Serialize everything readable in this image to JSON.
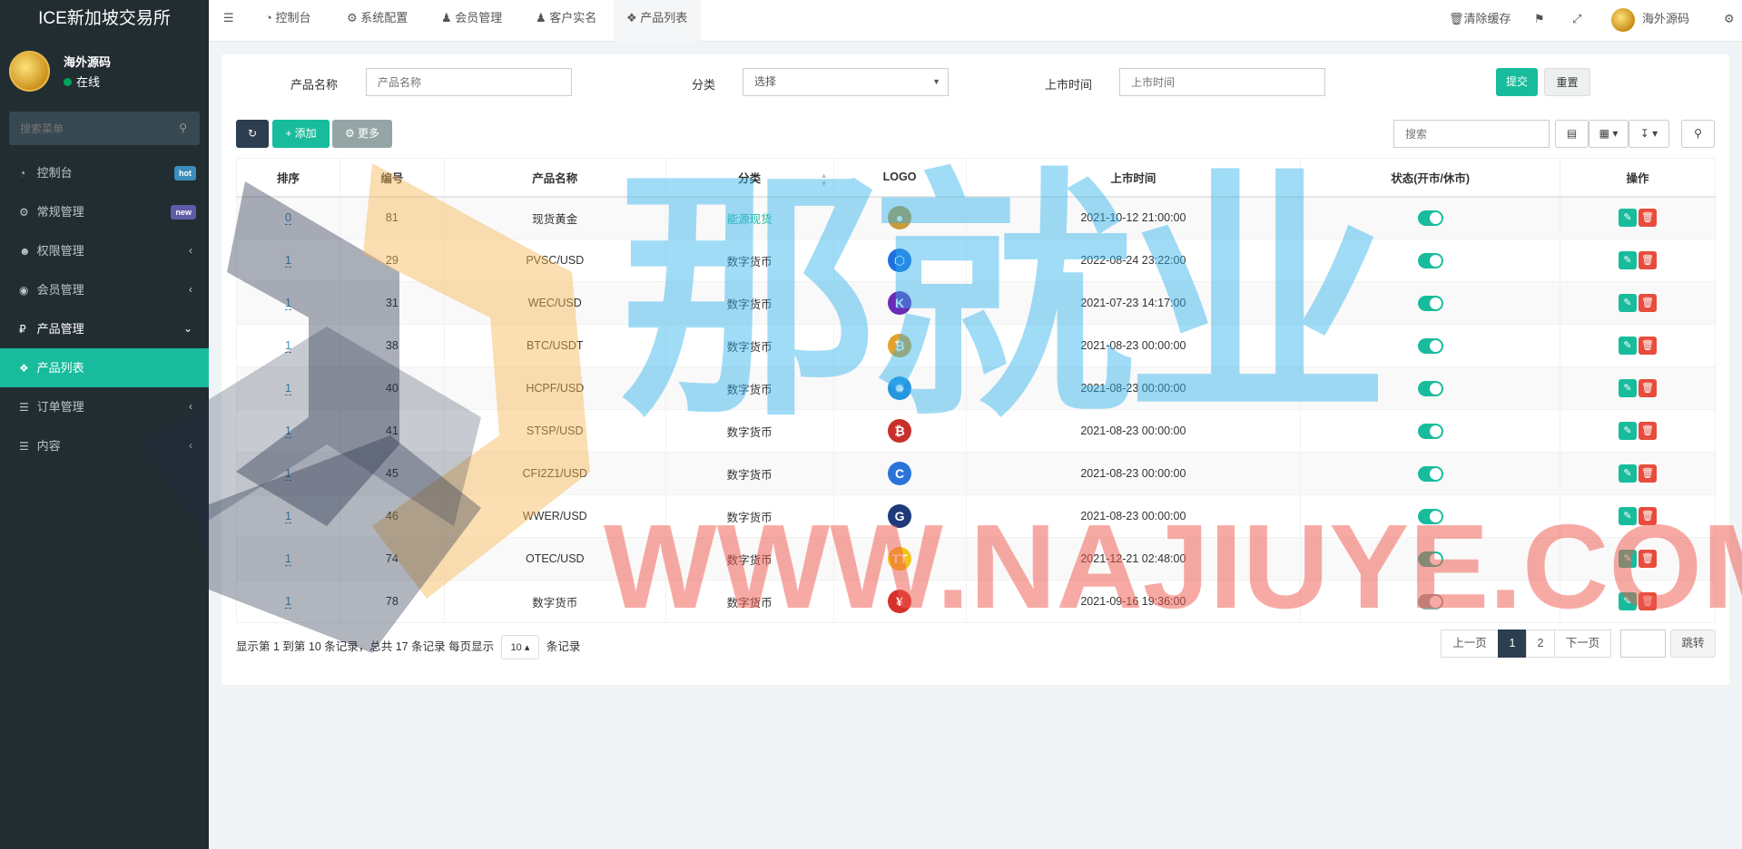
{
  "app": {
    "title": "ICE新加坡交易所"
  },
  "user": {
    "name": "海外源码",
    "status": "在线"
  },
  "sidebar": {
    "search_placeholder": "搜索菜单",
    "items": [
      {
        "label": "控制台",
        "icon": "dashboard-icon",
        "badge": "hot",
        "badge_color": "#3c8dbc"
      },
      {
        "label": "常规管理",
        "icon": "cogs-icon",
        "badge": "new",
        "badge_color": "#605ca8"
      },
      {
        "label": "权限管理",
        "icon": "group-icon"
      },
      {
        "label": "会员管理",
        "icon": "user-circle-icon"
      },
      {
        "label": "产品管理",
        "icon": "ruble-icon"
      },
      {
        "label": "产品列表",
        "icon": "cubes-icon"
      },
      {
        "label": "订单管理",
        "icon": "list-icon"
      },
      {
        "label": "内容",
        "icon": "list-icon"
      }
    ]
  },
  "topbar": {
    "tabs": [
      "控制台",
      "系统配置",
      "会员管理",
      "客户实名",
      "产品列表"
    ],
    "clear_cache": "清除缓存",
    "username": "海外源码"
  },
  "filter": {
    "name_label": "产品名称",
    "name_placeholder": "产品名称",
    "category_label": "分类",
    "category_value": "选择",
    "time_label": "上市时间",
    "time_placeholder": "上市时间",
    "submit": "提交",
    "reset": "重置"
  },
  "toolbar": {
    "add": "添加",
    "more": "更多",
    "search_placeholder": "搜索"
  },
  "table": {
    "columns": [
      "排序",
      "编号",
      "产品名称",
      "分类",
      "LOGO",
      "上市时间",
      "状态(开市/休市)",
      "操作"
    ],
    "rows": [
      {
        "sort": "0",
        "id": "81",
        "name": "现货黃金",
        "category": "能源现货",
        "time": "2021-10-12 21:00:00",
        "logo": "gold-coin-logo",
        "status": "on"
      },
      {
        "sort": "1",
        "id": "29",
        "name": "PVSC/USD",
        "category": "数字货币",
        "time": "2022-08-24 23:22:00",
        "logo": "hexagon-logo",
        "status": "on"
      },
      {
        "sort": "1",
        "id": "31",
        "name": "WEC/USD",
        "category": "数字货币",
        "time": "2021-07-23 14:17:00",
        "logo": "k-logo",
        "status": "on"
      },
      {
        "sort": "1",
        "id": "38",
        "name": "BTC/USDT",
        "category": "数字货币",
        "time": "2021-08-23 00:00:00",
        "logo": "bitcoin-logo",
        "status": "on"
      },
      {
        "sort": "1",
        "id": "40",
        "name": "HCPF/USD",
        "category": "数字货币",
        "time": "2021-08-23 00:00:00",
        "logo": "gear-logo",
        "status": "on"
      },
      {
        "sort": "1",
        "id": "41",
        "name": "STSP/USD",
        "category": "数字货币",
        "time": "2021-08-23 00:00:00",
        "logo": "bitcoin-heart-logo",
        "status": "on"
      },
      {
        "sort": "1",
        "id": "45",
        "name": "CFI2Z1/USD",
        "category": "数字货币",
        "time": "2021-08-23 00:00:00",
        "logo": "c-logo",
        "status": "on"
      },
      {
        "sort": "1",
        "id": "46",
        "name": "WWER/USD",
        "category": "数字货币",
        "time": "2021-08-23 00:00:00",
        "logo": "g-logo",
        "status": "on"
      },
      {
        "sort": "1",
        "id": "74",
        "name": "OTEC/USD",
        "category": "数字货币",
        "time": "2021-12-21 02:48:00",
        "logo": "tt-logo",
        "status": "on"
      },
      {
        "sort": "1",
        "id": "78",
        "name": "数字货币",
        "category": "数字货币",
        "time": "2021-09-16 19:36:00",
        "logo": "yuan-logo",
        "status": "off"
      }
    ]
  },
  "footer": {
    "summary": "显示第 1 到第 10 条记录，总共 17 条记录 每页显示",
    "page_size": "10",
    "unit": "条记录",
    "prev": "上一页",
    "next": "下一页",
    "pages": [
      "1",
      "2"
    ],
    "jump": "跳转"
  },
  "watermark": {
    "text_cn": "那就业",
    "text_en": "WWW.NAJIUYE.COM"
  }
}
